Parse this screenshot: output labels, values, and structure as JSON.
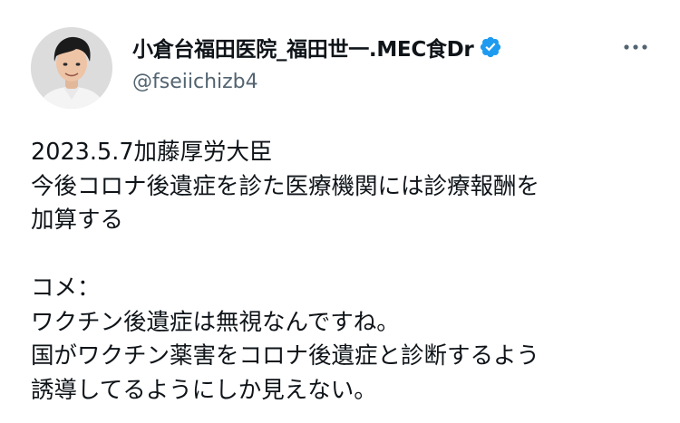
{
  "tweet": {
    "author": {
      "display_name": "小倉台福田医院_福田世一.MEC食Dr",
      "handle": "@fseiichizb4",
      "verified": true,
      "verified_icon": "verified-badge-icon",
      "verified_color": "#1d9bf0"
    },
    "more_icon": "more-horizontal-icon",
    "lines": [
      "2023.5.7加藤厚労大臣",
      "今後コロナ後遺症を診た医療機関には診療報酬を",
      "加算する",
      "",
      "コメ：",
      "ワクチン後遺症は無視なんですね。",
      "国がワクチン薬害をコロナ後遺症と診断するよう",
      "誘導してるようにしか見えない。"
    ]
  },
  "colors": {
    "text": "#0f1419",
    "secondary": "#536471",
    "accent": "#1d9bf0",
    "background": "#ffffff"
  }
}
